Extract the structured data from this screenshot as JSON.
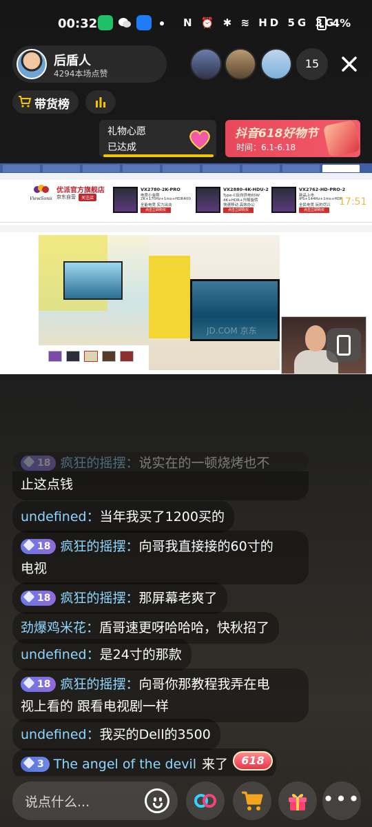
{
  "status_bar": {
    "time": "00:32",
    "icons_text": "N ⏰ ✱ ≋ HD 5G 3G",
    "battery": "4%"
  },
  "streamer": {
    "name": "后盾人",
    "likes": "4294本场点赞"
  },
  "viewers": {
    "count": "15"
  },
  "chips": {
    "rank_label": "带货榜"
  },
  "gift_wish": {
    "title": "礼物心愿",
    "status": "已达成"
  },
  "festival": {
    "title": "抖音618好物节",
    "date": "时间：6.1-6.18"
  },
  "screen_share": {
    "shop_name": "优派官方旗舰店",
    "shop_sub": "京东自营",
    "follow": "关注店",
    "logo_text": "ViewSonic",
    "ads": [
      {
        "title": "VX2780-2K-PRO",
        "l1": "电竞小金刚",
        "l2": "2K+170Hz+1ms+HDR400",
        "l3": "全能电竞 实力出击",
        "btn": "点击立即购买"
      },
      {
        "title": "VX2880-4K-HDU-2",
        "l1": "Type-C反向供电65W",
        "l2": "4K+HDR+升降旋转",
        "l3": "快速移动 高效办公",
        "btn": "点击立即购买"
      },
      {
        "title": "VX2762-HD-PRO-2",
        "l1": "新品上市",
        "l2": "IPS+144Hz+1ms+HDR",
        "l3": "全民电竞 玩的尽兴",
        "btn": "点击立即购买"
      }
    ],
    "overlay_time": "17:51",
    "watermark": "JD.COM 京东"
  },
  "chat": [
    {
      "level": "18",
      "nick": "疯狂的摇摆",
      "text": "说实在的一顿烧烤也不",
      "faded": true
    },
    {
      "level": "",
      "nick": "",
      "text": "止这点钱",
      "faded": false
    },
    {
      "level": "",
      "nick": "undefined",
      "text": "当年我买了1200买的"
    },
    {
      "level": "18",
      "nick": "疯狂的摇摆",
      "text": "向哥我直接接的60寸的",
      "cont": "电视"
    },
    {
      "level": "18",
      "nick": "疯狂的摇摆",
      "text": "那屏幕老爽了"
    },
    {
      "level": "",
      "nick": "劲爆鸡米花",
      "text": "盾哥速更呀哈哈哈，快秋招了"
    },
    {
      "level": "",
      "nick": "undefined",
      "text": "是24寸的那款"
    },
    {
      "level": "18",
      "nick": "疯狂的摇摆",
      "text": "向哥你那教程我弄在电",
      "cont": "视上看的 跟看电视剧一样"
    },
    {
      "level": "",
      "nick": "undefined",
      "text": "我买的Dell的3500"
    },
    {
      "level": "3",
      "nick": "",
      "text": "The angel of the devil",
      "suffix": "来了"
    }
  ],
  "badge_618": "618",
  "input": {
    "placeholder": "说点什么..."
  },
  "colors": {
    "accent_yellow": "#f5c400",
    "nick_blue": "#8fd7ff",
    "festival_red": "#e8485b"
  }
}
